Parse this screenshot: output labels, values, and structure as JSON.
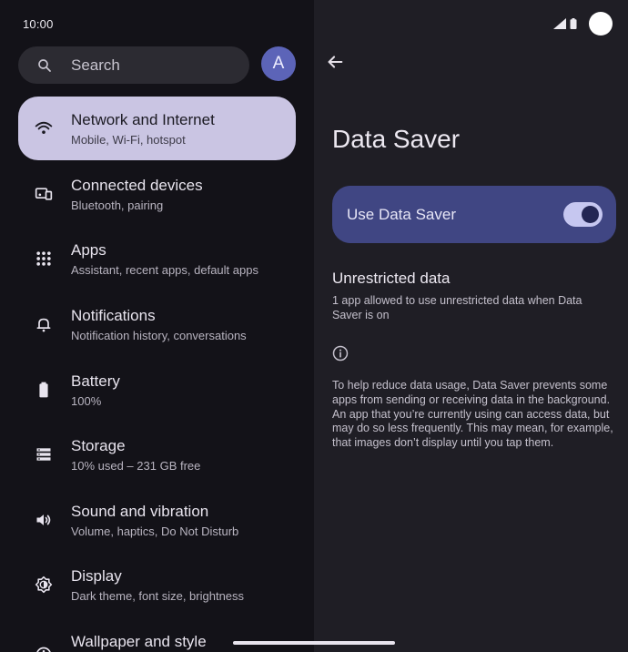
{
  "status_bar": {
    "time": "10:00"
  },
  "search": {
    "label": "Search",
    "icon": "search-icon"
  },
  "avatar": {
    "initial": "A",
    "color": "#5c64b8"
  },
  "settings": {
    "items": [
      {
        "title": "Network and Internet",
        "subtitle": "Mobile, Wi-Fi, hotspot",
        "icon": "wifi-icon",
        "selected": true
      },
      {
        "title": "Connected devices",
        "subtitle": "Bluetooth, pairing",
        "icon": "devices-icon"
      },
      {
        "title": "Apps",
        "subtitle": "Assistant, recent apps, default apps",
        "icon": "apps-grid-icon"
      },
      {
        "title": "Notifications",
        "subtitle": "Notification history, conversations",
        "icon": "bell-icon"
      },
      {
        "title": "Battery",
        "subtitle": "100%",
        "icon": "battery-icon"
      },
      {
        "title": "Storage",
        "subtitle": "10% used – 231 GB free",
        "icon": "storage-icon"
      },
      {
        "title": "Sound and vibration",
        "subtitle": "Volume, haptics, Do Not Disturb",
        "icon": "volume-icon"
      },
      {
        "title": "Display",
        "subtitle": "Dark theme, font size, brightness",
        "icon": "display-icon"
      },
      {
        "title": "Wallpaper and style",
        "subtitle": "",
        "icon": "palette-icon"
      }
    ]
  },
  "detail": {
    "title": "Data Saver",
    "toggle": {
      "label": "Use Data Saver",
      "on": true
    },
    "unrestricted": {
      "title": "Unrestricted data",
      "subtitle": "1 app allowed to use unrestricted data when Data Saver is on"
    },
    "info_text": "To help reduce data usage, Data Saver prevents some apps from sending or receiving data in the background. An app that you’re currently using can access data, but may do so less frequently. This may mean, for example, that images don’t display until you tap them."
  },
  "colors": {
    "selected_item_bg": "#cac5e3",
    "toggle_card_bg": "#404683",
    "switch_track": "#c6c7f0"
  }
}
